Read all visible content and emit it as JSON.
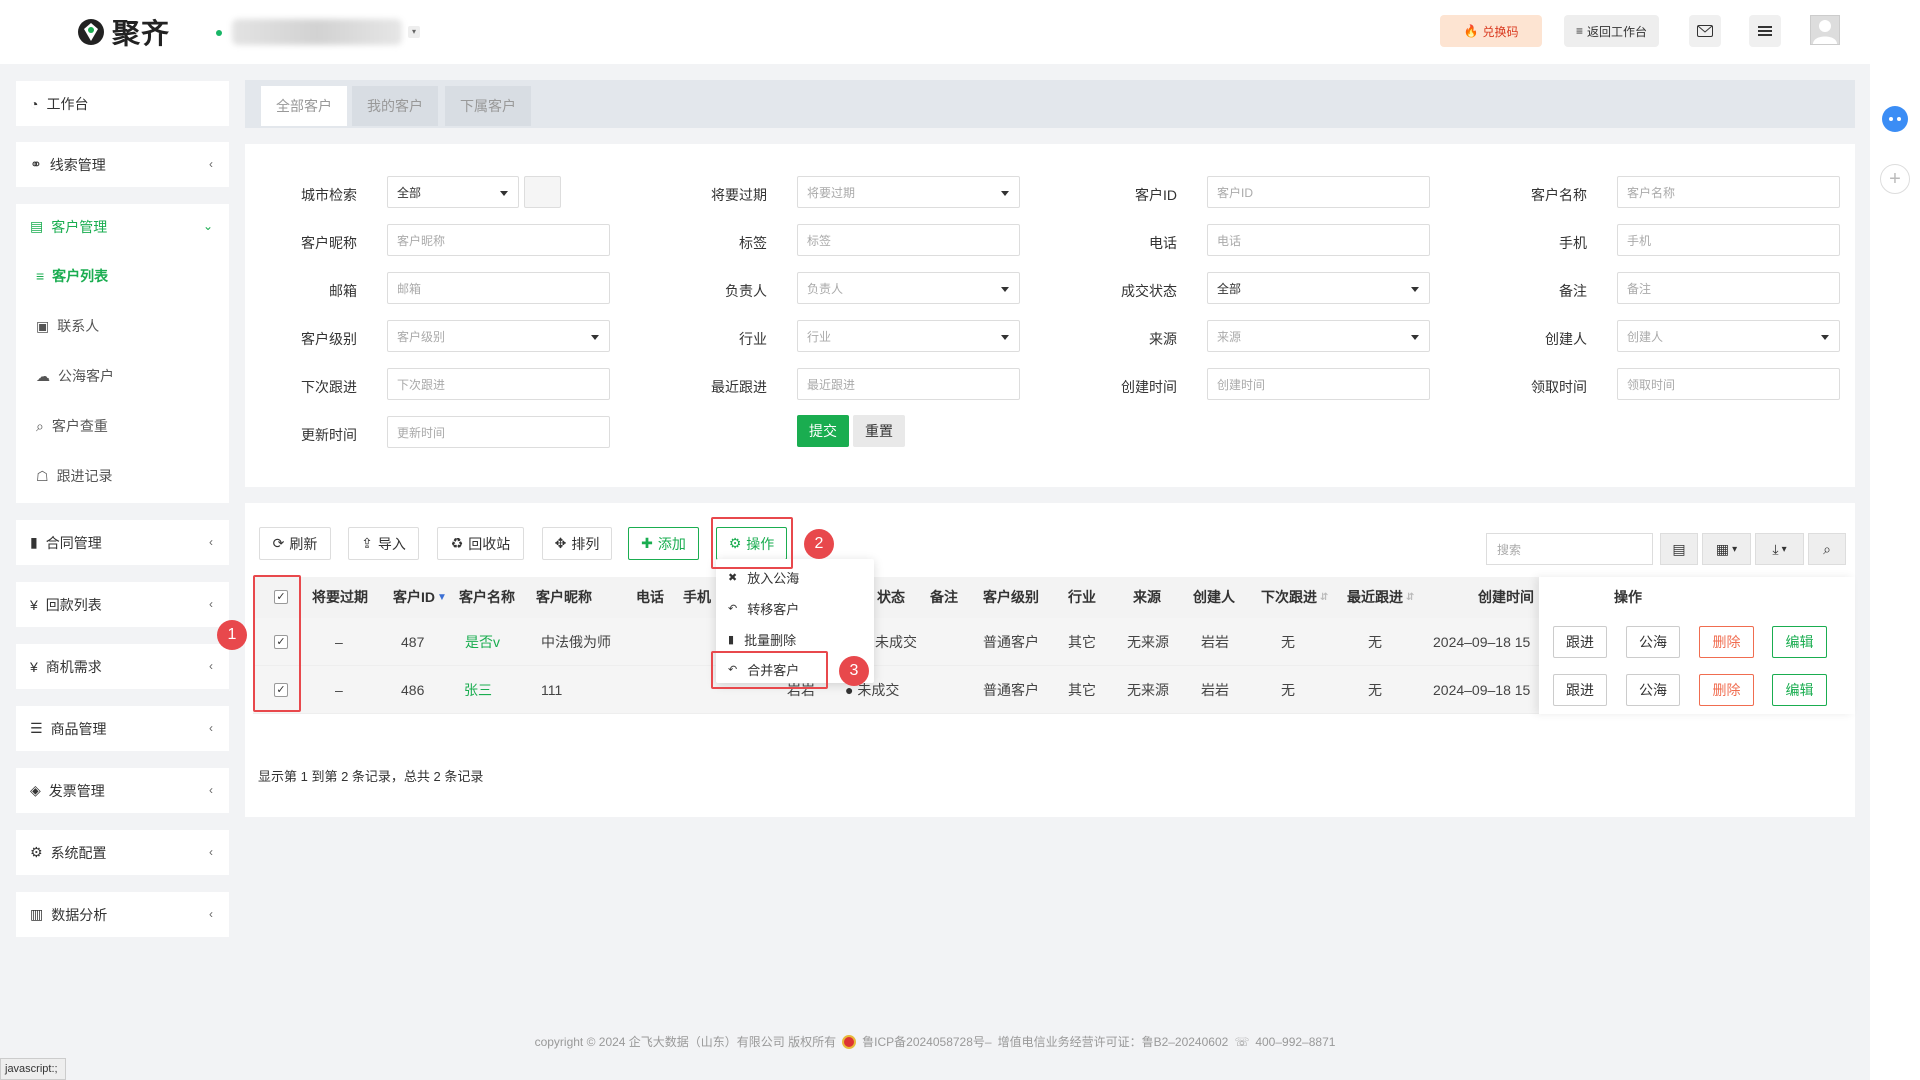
{
  "app": {
    "logo_text": "聚齐"
  },
  "topbar": {
    "redeem_label": "兑换码",
    "return_label": "返回工作台"
  },
  "sidebar": {
    "items": [
      {
        "label": "工作台"
      },
      {
        "label": "线索管理"
      },
      {
        "label": "客户管理"
      },
      {
        "label": "合同管理"
      },
      {
        "label": "回款列表"
      },
      {
        "label": "商机需求"
      },
      {
        "label": "商品管理"
      },
      {
        "label": "发票管理"
      },
      {
        "label": "系统配置"
      },
      {
        "label": "数据分析"
      }
    ],
    "sub_items": [
      {
        "label": "客户列表"
      },
      {
        "label": "联系人"
      },
      {
        "label": "公海客户"
      },
      {
        "label": "客户查重"
      },
      {
        "label": "跟进记录"
      }
    ]
  },
  "tabs": [
    "全部客户",
    "我的客户",
    "下属客户"
  ],
  "filters": {
    "city": {
      "label": "城市检索",
      "value": "全部"
    },
    "expiring": {
      "label": "将要过期",
      "placeholder": "将要过期"
    },
    "customer_id": {
      "label": "客户ID",
      "placeholder": "客户ID"
    },
    "customer_name": {
      "label": "客户名称",
      "placeholder": "客户名称"
    },
    "nickname": {
      "label": "客户昵称",
      "placeholder": "客户昵称"
    },
    "tag": {
      "label": "标签",
      "placeholder": "标签"
    },
    "phone": {
      "label": "电话",
      "placeholder": "电话"
    },
    "mobile": {
      "label": "手机",
      "placeholder": "手机"
    },
    "email": {
      "label": "邮箱",
      "placeholder": "邮箱"
    },
    "owner": {
      "label": "负责人",
      "placeholder": "负责人"
    },
    "deal_status": {
      "label": "成交状态",
      "value": "全部"
    },
    "remark": {
      "label": "备注",
      "placeholder": "备注"
    },
    "level": {
      "label": "客户级别",
      "placeholder": "客户级别"
    },
    "industry": {
      "label": "行业",
      "placeholder": "行业"
    },
    "source": {
      "label": "来源",
      "placeholder": "来源"
    },
    "creator": {
      "label": "创建人",
      "placeholder": "创建人"
    },
    "next_follow": {
      "label": "下次跟进",
      "placeholder": "下次跟进"
    },
    "last_follow": {
      "label": "最近跟进",
      "placeholder": "最近跟进"
    },
    "create_time": {
      "label": "创建时间",
      "placeholder": "创建时间"
    },
    "claim_time": {
      "label": "领取时间",
      "placeholder": "领取时间"
    },
    "update_time": {
      "label": "更新时间",
      "placeholder": "更新时间"
    },
    "submit_label": "提交",
    "reset_label": "重置"
  },
  "toolbar": {
    "refresh": "刷新",
    "import": "导入",
    "recycle": "回收站",
    "sort": "排列",
    "add": "添加",
    "operate": "操作",
    "search_placeholder": "搜索"
  },
  "dropdown": [
    "放入公海",
    "转移客户",
    "批量删除",
    "合并客户"
  ],
  "table": {
    "headers": [
      "将要过期",
      "客户ID",
      "客户名称",
      "客户昵称",
      "电话",
      "手机",
      "状态",
      "备注",
      "客户级别",
      "行业",
      "来源",
      "创建人",
      "下次跟进",
      "最近跟进",
      "创建时间",
      "操作"
    ],
    "rows": [
      {
        "expiring": "–",
        "id": "487",
        "name": "是否v",
        "nickname": "中法俄为师",
        "owner": "",
        "status": "未成交",
        "level": "普通客户",
        "industry": "其它",
        "source": "无来源",
        "creator": "岩岩",
        "next": "无",
        "last": "无",
        "created": "2024–09–18 15"
      },
      {
        "expiring": "–",
        "id": "486",
        "name": "张三",
        "nickname": "111",
        "owner": "岩岩",
        "status": "未成交",
        "level": "普通客户",
        "industry": "其它",
        "source": "无来源",
        "creator": "岩岩",
        "next": "无",
        "last": "无",
        "created": "2024–09–18 15"
      }
    ],
    "actions": {
      "follow": "跟进",
      "public": "公海",
      "delete": "删除",
      "edit": "编辑"
    }
  },
  "records_text": "显示第 1 到第 2 条记录，总共 2 条记录",
  "annotations": [
    "1",
    "2",
    "3"
  ],
  "footer": {
    "copyright": "copyright © 2024 企飞大数据（山东）有限公司 版权所有",
    "icp": "鲁ICP备2024058728号–",
    "license": "增值电信业务经营许可证：鲁B2–20240602",
    "phone": "400–992–8871"
  },
  "status_tip": "javascript:;",
  "colors": {
    "primary": "#1aad50",
    "danger": "#f06d50",
    "annotation": "#e8484c"
  }
}
